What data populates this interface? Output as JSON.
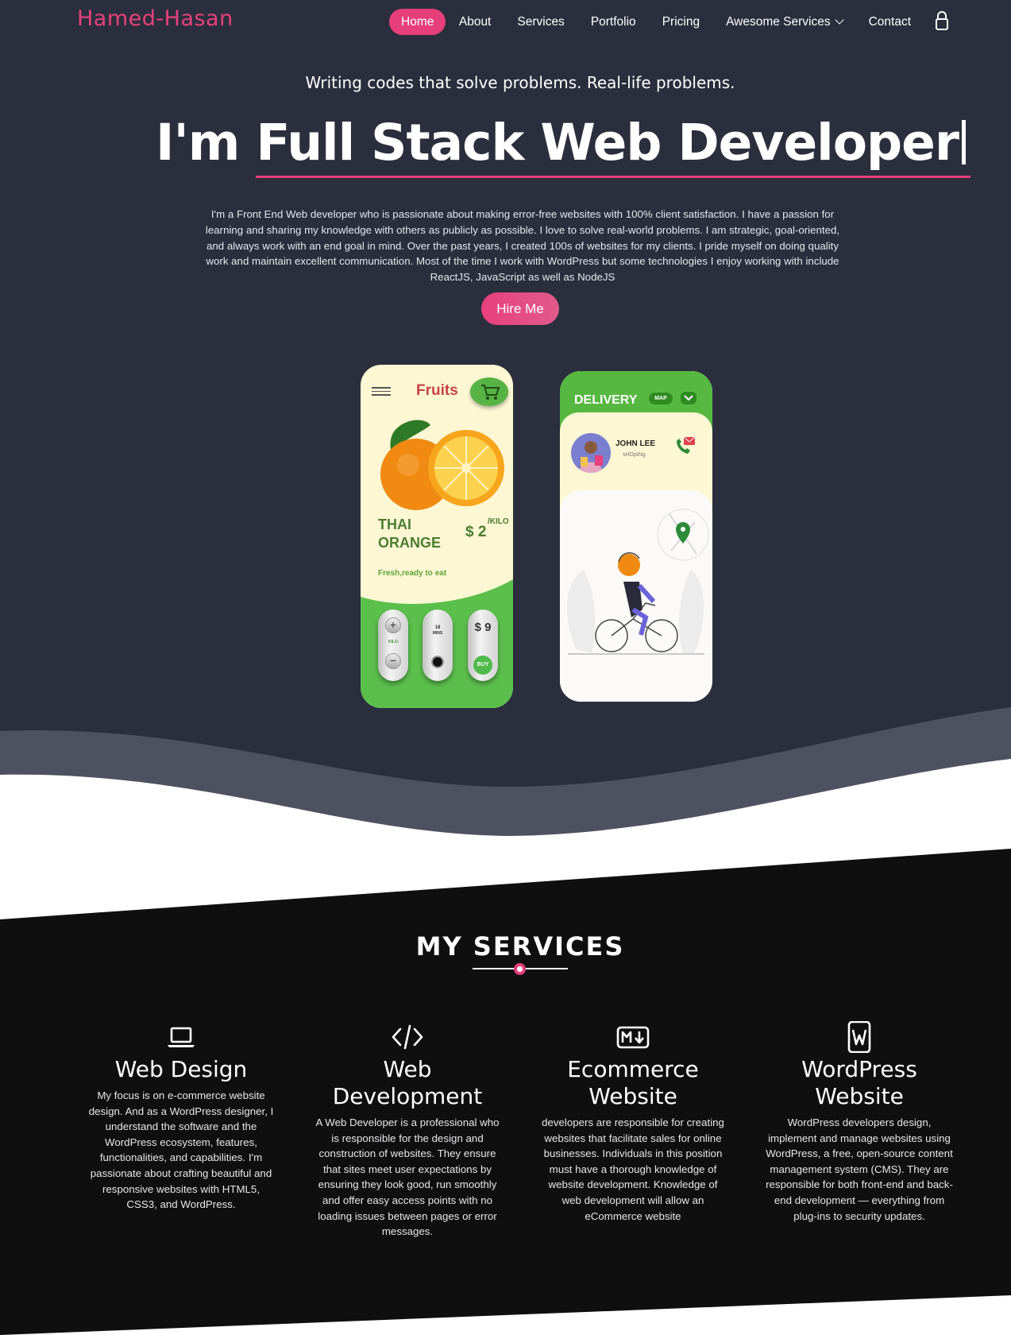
{
  "nav": {
    "logo": "Hamed-Hasan",
    "items": [
      {
        "label": "Home",
        "active": true
      },
      {
        "label": "About"
      },
      {
        "label": "Services"
      },
      {
        "label": "Portfolio"
      },
      {
        "label": "Pricing"
      },
      {
        "label": "Awesome Services",
        "dropdown": true
      },
      {
        "label": "Contact"
      }
    ],
    "lock_icon": "lock-icon"
  },
  "hero": {
    "tagline": "Writing codes that solve problems. Real-life problems.",
    "headline_prefix": "I'm ",
    "headline_typed": "Full Stack Web Developer",
    "bio": "I'm a Front End Web developer who is passionate about making error-free websites with 100% client satisfaction. I have a passion for learning and sharing my knowledge with others as publicly as possible. I love to solve real-world problems. I am strategic, goal-oriented, and always work with an end goal in mind. Over the past years, I created 100s of websites for my clients. I pride myself on doing quality work and maintain excellent communication. Most of the time I work with WordPress but some technologies I enjoy working with include ReactJS, JavaScript as well as NodeJS",
    "cta": "Hire Me"
  },
  "mockup_fruit": {
    "title": "Fruits",
    "name_line1": "THAI",
    "name_line2": "ORANGE",
    "price": "$ 2",
    "unit": "/KILO",
    "tagline": "Fresh,ready to eat",
    "kilo": "KILO",
    "mins_value": "18",
    "mins_label": "MINS",
    "total": "$ 9",
    "buy": "BUY"
  },
  "mockup_delivery": {
    "title": "DELIVERY",
    "map": "MAP",
    "name": "JOHN LEE",
    "sub": "sHOpINg"
  },
  "services": {
    "title": "MY SERVICES",
    "items": [
      {
        "icon": "laptop-icon",
        "name": "Web Design",
        "desc": "My focus is on e-commerce website design. And as a WordPress designer, I understand the software and the WordPress ecosystem, features, functionalities, and capabilities. I'm passionate about crafting beautiful and responsive websites with HTML5, CSS3, and WordPress."
      },
      {
        "icon": "code-icon",
        "name": "Web Development",
        "desc": "A Web Developer is a professional who is responsible for the design and construction of websites. They ensure that sites meet user expectations by ensuring they look good, run smoothly and offer easy access points with no loading issues between pages or error messages."
      },
      {
        "icon": "markdown-icon",
        "name": "Ecommerce Website",
        "desc": "developers are responsible for creating websites that facilitate sales for online businesses. Individuals in this position must have a thorough knowledge of website development. Knowledge of web development will allow an eCommerce website"
      },
      {
        "icon": "wordpress-file-icon",
        "name": "WordPress Website",
        "desc": "WordPress developers design, implement and manage websites using WordPress, a free, open-source content management system (CMS). They are responsible for both front-end and back-end development — everything from plug-ins to security updates."
      }
    ]
  },
  "colors": {
    "accent": "#e63f79",
    "hero_bg": "#2b2f3d",
    "services_bg": "#0f0f10"
  }
}
